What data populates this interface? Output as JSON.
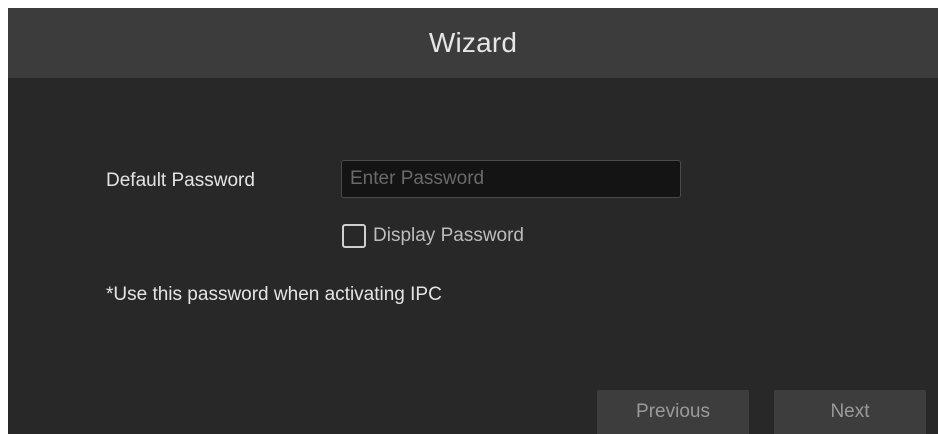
{
  "dialog": {
    "title": "Wizard"
  },
  "form": {
    "default_password_label": "Default Password",
    "password_placeholder": "Enter Password",
    "password_value": "",
    "display_password_label": "Display Password",
    "display_password_checked": false,
    "note": "*Use this password when activating IPC"
  },
  "buttons": {
    "previous_label": "Previous",
    "next_label": "Next"
  },
  "colors": {
    "background": "#282828",
    "titlebar": "#3c3c3c",
    "button": "#3d3d3d",
    "input": "#141414"
  }
}
